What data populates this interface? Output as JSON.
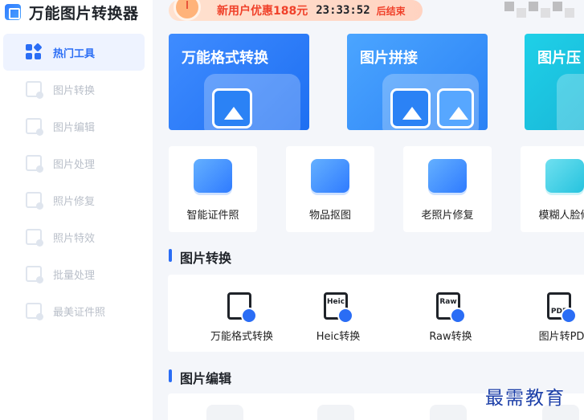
{
  "app": {
    "title": "万能图片转换器"
  },
  "promo": {
    "text": "新用户优惠188元",
    "time": "23:33:52",
    "suffix": "后结束"
  },
  "sidebar": {
    "items": [
      {
        "label": "热门工具",
        "active": true
      },
      {
        "label": "图片转换"
      },
      {
        "label": "图片编辑"
      },
      {
        "label": "图片处理"
      },
      {
        "label": "照片修复"
      },
      {
        "label": "照片特效"
      },
      {
        "label": "批量处理"
      },
      {
        "label": "最美证件照"
      }
    ]
  },
  "features": [
    {
      "title": "万能格式转换"
    },
    {
      "title": "图片拼接"
    },
    {
      "title": "图片压"
    }
  ],
  "tools": [
    {
      "label": "智能证件照"
    },
    {
      "label": "物品抠图"
    },
    {
      "label": "老照片修复"
    },
    {
      "label": "模糊人脸修"
    }
  ],
  "sections": {
    "convert": {
      "title": "图片转换"
    },
    "edit": {
      "title": "图片编辑"
    }
  },
  "convert_tools": [
    {
      "label": "万能格式转换",
      "tag": ""
    },
    {
      "label": "Heic转换",
      "tag": "Heic"
    },
    {
      "label": "Raw转换",
      "tag": "Raw"
    },
    {
      "label": "图片转PD",
      "tag": "PDF"
    }
  ],
  "watermark": "最需教育",
  "colors": {
    "accent": "#2a6df5",
    "promo": "#f0412a"
  }
}
